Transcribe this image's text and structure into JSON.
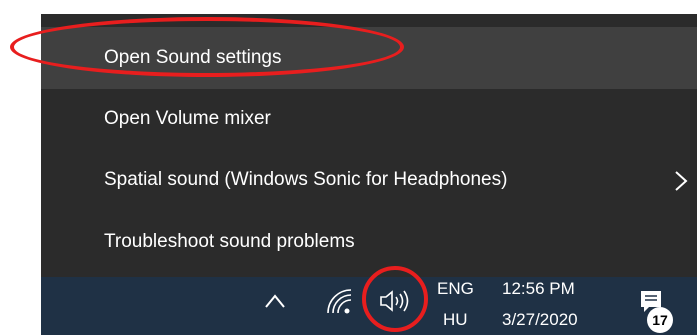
{
  "menu": {
    "items": [
      {
        "label": "Open Sound settings"
      },
      {
        "label": "Open Volume mixer"
      },
      {
        "label": "Spatial sound (Windows Sonic for Headphones)"
      },
      {
        "label": "Troubleshoot sound problems"
      }
    ]
  },
  "taskbar": {
    "language": "ENG",
    "region": "HU",
    "time": "12:56 PM",
    "date": "3/27/2020",
    "notification_count": "17"
  },
  "icons": {
    "chevron": "chevron-right-icon",
    "tray_expand": "chevron-up-icon",
    "network": "wifi-icon",
    "volume": "speaker-icon",
    "notifications": "action-center-icon"
  },
  "colors": {
    "menu_bg": "#2b2b2b",
    "menu_hover": "#404040",
    "taskbar_bg": "#1f3145",
    "annotation": "#e81e1e"
  }
}
